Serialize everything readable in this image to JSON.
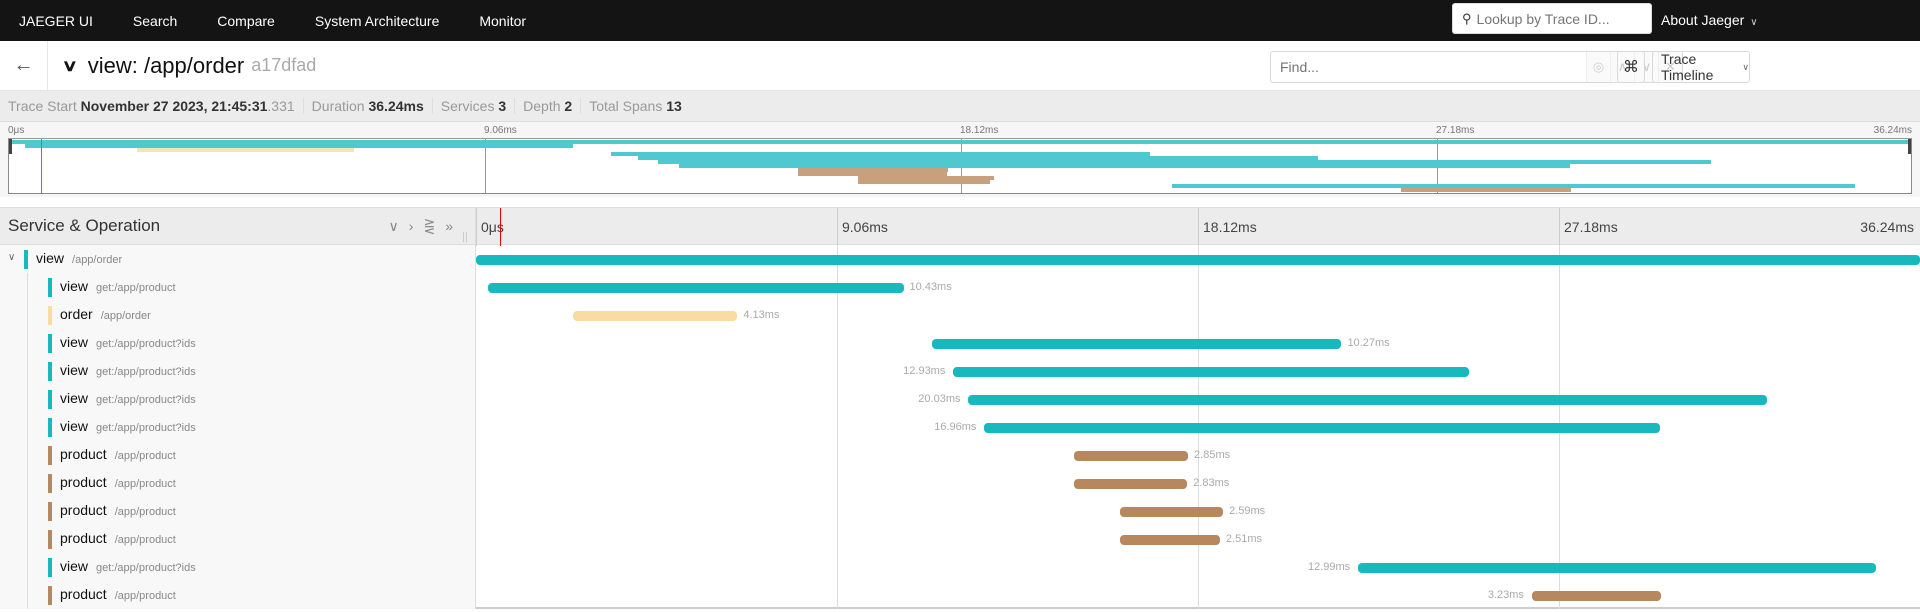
{
  "nav": {
    "brand": "JAEGER UI",
    "items": [
      "Search",
      "Compare",
      "System Architecture",
      "Monitor"
    ],
    "lookup_placeholder": "Lookup by Trace ID...",
    "about": "About Jaeger"
  },
  "trace": {
    "back_icon": "arrow-left-icon",
    "title": "view: /app/order",
    "trace_id": "a17dfad",
    "find_placeholder": "Find...",
    "keyboard_icon": "⌘",
    "view_mode": "Trace Timeline"
  },
  "summary": {
    "trace_start_label": "Trace Start",
    "trace_start_value": "November 27 2023, 21:45:31",
    "trace_start_ms": ".331",
    "duration_label": "Duration",
    "duration_value": "36.24ms",
    "services_label": "Services",
    "services_value": "3",
    "depth_label": "Depth",
    "depth_value": "2",
    "total_spans_label": "Total Spans",
    "total_spans_value": "13"
  },
  "timeline": {
    "header_label": "Service & Operation",
    "ticks": [
      "0μs",
      "9.06ms",
      "18.12ms",
      "27.18ms",
      "36.24ms"
    ],
    "total_ms": 36.24,
    "cursor_ms": 0.6
  },
  "colors": {
    "view": "#17b8be",
    "order": "#f8dca1",
    "product": "#b7885e",
    "view_mini": "#4fc9cf",
    "order_mini": "#f8e3b6",
    "product_mini": "#c9a07d"
  },
  "spans": [
    {
      "service": "view",
      "operation": "/app/order",
      "start_ms": 0,
      "duration_ms": 36.24,
      "duration_label": "",
      "depth": 0,
      "label_side": "none"
    },
    {
      "service": "view",
      "operation": "get:/app/product",
      "start_ms": 0.3,
      "duration_ms": 10.43,
      "duration_label": "10.43ms",
      "depth": 1,
      "label_side": "right"
    },
    {
      "service": "order",
      "operation": "/app/order",
      "start_ms": 2.43,
      "duration_ms": 4.13,
      "duration_label": "4.13ms",
      "depth": 1,
      "label_side": "right"
    },
    {
      "service": "view",
      "operation": "get:/app/product?ids",
      "start_ms": 11.45,
      "duration_ms": 10.27,
      "duration_label": "10.27ms",
      "depth": 1,
      "label_side": "right"
    },
    {
      "service": "view",
      "operation": "get:/app/product?ids",
      "start_ms": 11.98,
      "duration_ms": 12.93,
      "duration_label": "12.93ms",
      "depth": 1,
      "label_side": "left"
    },
    {
      "service": "view",
      "operation": "get:/app/product?ids",
      "start_ms": 12.36,
      "duration_ms": 20.03,
      "duration_label": "20.03ms",
      "depth": 1,
      "label_side": "left"
    },
    {
      "service": "view",
      "operation": "get:/app/product?ids",
      "start_ms": 12.76,
      "duration_ms": 16.96,
      "duration_label": "16.96ms",
      "depth": 1,
      "label_side": "left"
    },
    {
      "service": "product",
      "operation": "/app/product",
      "start_ms": 15.02,
      "duration_ms": 2.85,
      "duration_label": "2.85ms",
      "depth": 1,
      "label_side": "right"
    },
    {
      "service": "product",
      "operation": "/app/product",
      "start_ms": 15.02,
      "duration_ms": 2.83,
      "duration_label": "2.83ms",
      "depth": 1,
      "label_side": "right"
    },
    {
      "service": "product",
      "operation": "/app/product",
      "start_ms": 16.16,
      "duration_ms": 2.59,
      "duration_label": "2.59ms",
      "depth": 1,
      "label_side": "right"
    },
    {
      "service": "product",
      "operation": "/app/product",
      "start_ms": 16.16,
      "duration_ms": 2.51,
      "duration_label": "2.51ms",
      "depth": 1,
      "label_side": "right"
    },
    {
      "service": "view",
      "operation": "get:/app/product?ids",
      "start_ms": 22.14,
      "duration_ms": 12.99,
      "duration_label": "12.99ms",
      "depth": 1,
      "label_side": "left"
    },
    {
      "service": "product",
      "operation": "/app/product",
      "start_ms": 26.5,
      "duration_ms": 3.23,
      "duration_label": "3.23ms",
      "depth": 1,
      "label_side": "left"
    }
  ]
}
